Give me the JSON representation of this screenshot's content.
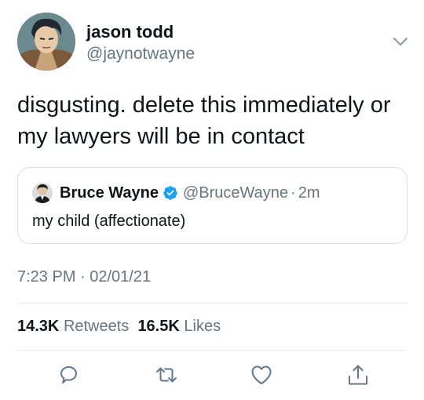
{
  "author": {
    "display_name": "jason todd",
    "handle": "@jaynotwayne",
    "avatar_icon": "avatar-illustration"
  },
  "tweet": {
    "text_line1": "disgusting. delete this immediately or",
    "text_line2": "my lawyers will be in contact",
    "timestamp": "7:23 PM · 02/01/21"
  },
  "quoted_tweet": {
    "display_name": "Bruce Wayne",
    "verified": true,
    "handle": "@BruceWayne",
    "separator": "·",
    "age": "2m",
    "text": "my child (affectionate)"
  },
  "stats": {
    "retweets_count": "14.3K",
    "retweets_label": "Retweets",
    "likes_count": "16.5K",
    "likes_label": "Likes"
  },
  "actions": [
    "reply-icon",
    "retweet-icon",
    "like-icon",
    "share-icon"
  ],
  "colors": {
    "text_primary": "#0f1419",
    "text_secondary": "#66757f",
    "border": "#d8e0e6",
    "divider": "#e6ecf0",
    "verified_blue": "#1da1f2",
    "icon_gray": "#657786"
  }
}
